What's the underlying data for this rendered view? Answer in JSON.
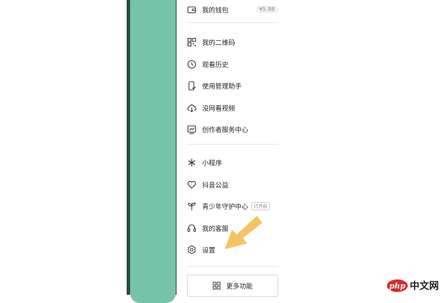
{
  "menu": {
    "wallet": {
      "label": "我的钱包",
      "balance": "¥5.98",
      "icon": "wallet-icon"
    },
    "qrcode": {
      "label": "我的二维码",
      "icon": "qrcode-icon"
    },
    "history": {
      "label": "观看历史",
      "icon": "clock-icon"
    },
    "manager": {
      "label": "使用管理助手",
      "icon": "phone-check-icon"
    },
    "offline": {
      "label": "没网看视频",
      "icon": "cloud-download-icon"
    },
    "creator": {
      "label": "创作者服务中心",
      "icon": "chart-screen-icon"
    },
    "miniapp": {
      "label": "小程序",
      "icon": "asterisk-icon"
    },
    "charity": {
      "label": "抖音公益",
      "icon": "heart-icon"
    },
    "youth": {
      "label": "青少年守护中心",
      "tag": "已开启",
      "icon": "sprout-icon"
    },
    "service": {
      "label": "我的客服",
      "icon": "headset-icon"
    },
    "settings": {
      "label": "设置",
      "icon": "gear-icon"
    }
  },
  "more_button": {
    "label": "更多功能",
    "icon": "grid-icon"
  },
  "annotation": {
    "arrow_color": "#f5c462",
    "points_to": "settings"
  },
  "watermark": {
    "logo_text": "php",
    "site_text": "中文网"
  },
  "colors": {
    "teal_cover": "#77c3a9",
    "strip_dark": "#13211d",
    "text": "#222222"
  }
}
